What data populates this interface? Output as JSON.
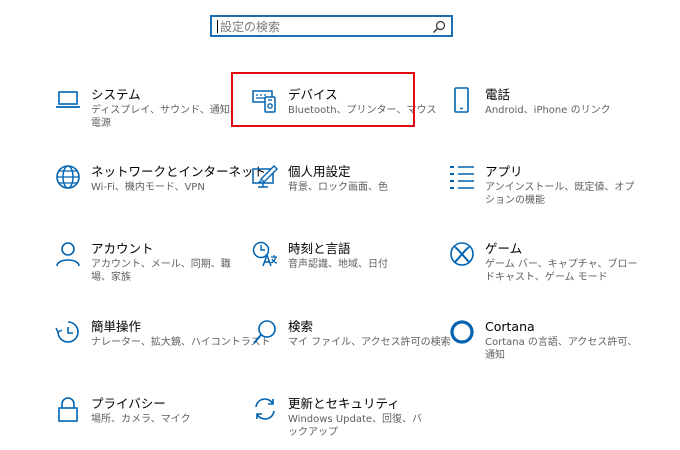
{
  "search": {
    "placeholder": "設定の検索"
  },
  "tiles": [
    {
      "title": "システム",
      "desc": "ディスプレイ、サウンド、通知、電源",
      "icon": "laptop-icon"
    },
    {
      "title": "デバイス",
      "desc": "Bluetooth、プリンター、マウス",
      "icon": "keyboard-device-icon"
    },
    {
      "title": "電話",
      "desc": "Android、iPhone のリンク",
      "icon": "phone-icon"
    },
    {
      "title": "ネットワークとインターネット",
      "desc": "Wi-Fi、機内モード、VPN",
      "icon": "globe-icon"
    },
    {
      "title": "個人用設定",
      "desc": "背景、ロック画面、色",
      "icon": "paint-brush-screen-icon"
    },
    {
      "title": "アプリ",
      "desc": "アンインストール、既定値、オプションの機能",
      "icon": "app-list-icon"
    },
    {
      "title": "アカウント",
      "desc": "アカウント、メール、同期、職場、家族",
      "icon": "person-icon"
    },
    {
      "title": "時刻と言語",
      "desc": "音声認識、地域、日付",
      "icon": "time-language-icon"
    },
    {
      "title": "ゲーム",
      "desc": "ゲーム バー、キャプチャ、ブロードキャスト、ゲーム モード",
      "icon": "xbox-icon"
    },
    {
      "title": "簡単操作",
      "desc": "ナレーター、拡大鏡、ハイコントラスト",
      "icon": "ease-of-access-icon"
    },
    {
      "title": "検索",
      "desc": "マイ ファイル、アクセス許可の検索",
      "icon": "magnifier-icon"
    },
    {
      "title": "Cortana",
      "desc": "Cortana の言語、アクセス許可、通知",
      "icon": "cortana-ring-icon"
    },
    {
      "title": "プライバシー",
      "desc": "場所、カメラ、マイク",
      "icon": "lock-icon"
    },
    {
      "title": "更新とセキュリティ",
      "desc": "Windows Update、回復、バックアップ",
      "icon": "refresh-icon"
    }
  ],
  "colors": {
    "accent": "#0063b1",
    "highlight": "#e30b10",
    "search_border": "#1a6fb5"
  }
}
